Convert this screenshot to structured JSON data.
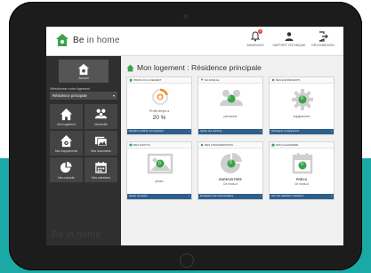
{
  "app": {
    "brand_be": "Be",
    "brand_rest": " in home"
  },
  "top_actions": [
    {
      "label": "Annonces",
      "icon": "bell-icon",
      "badge": "0"
    },
    {
      "label": "Support technique",
      "icon": "user-icon"
    },
    {
      "label": "Déconnexion",
      "icon": "logout-icon"
    }
  ],
  "sidebar": {
    "account_label": "Accueil",
    "select_label": "Sélectionner votre logement",
    "select_value": "Résidence principale",
    "items": [
      {
        "label": "Mon logement",
        "icon": "house-icon"
      },
      {
        "label": "Ma famille",
        "icon": "family-icon"
      },
      {
        "label": "Mes équipements",
        "icon": "appliance-house-icon"
      },
      {
        "label": "Mes documents",
        "icon": "photos-icon"
      },
      {
        "label": "Mes conseils",
        "icon": "pie-chart-icon"
      },
      {
        "label": "Mes entretiens",
        "icon": "calendar-icon"
      }
    ],
    "watermark": "Be in home"
  },
  "main": {
    "title": "Mon logement : Résidence principale",
    "cards": [
      {
        "head": "Profil du logement",
        "caption": "Profil rempli à",
        "value": "20 %",
        "foot": "Remplir le profil de mon logement",
        "progress": 0.2
      },
      {
        "head": "Ma famille",
        "caption": "personne",
        "foot": "Ajouter des membres"
      },
      {
        "head": "Mes équipements",
        "caption": "équipement",
        "foot": "Renseigner un équipement"
      },
      {
        "head": "Mes photos",
        "caption": "photo",
        "foot": "Ajouter une photo"
      },
      {
        "head": "Mes consommations",
        "caption_strong": "ENREGISTRÉE",
        "caption2": "Ce mois-ci",
        "foot": "Enregistrer mes consommations"
      },
      {
        "head": "Mon calendrier",
        "caption_strong": "PRÉVU",
        "caption2": "Ce mois-ci",
        "foot": "Voir mon calendrier / entretiens"
      }
    ],
    "badge_value": "0"
  },
  "colors": {
    "accent": "#2e5f8c",
    "green": "#3aa24a",
    "orange": "#f08a24",
    "teal_band": "#1aa9a4",
    "sidebar_bg": "#2f2f2f"
  }
}
